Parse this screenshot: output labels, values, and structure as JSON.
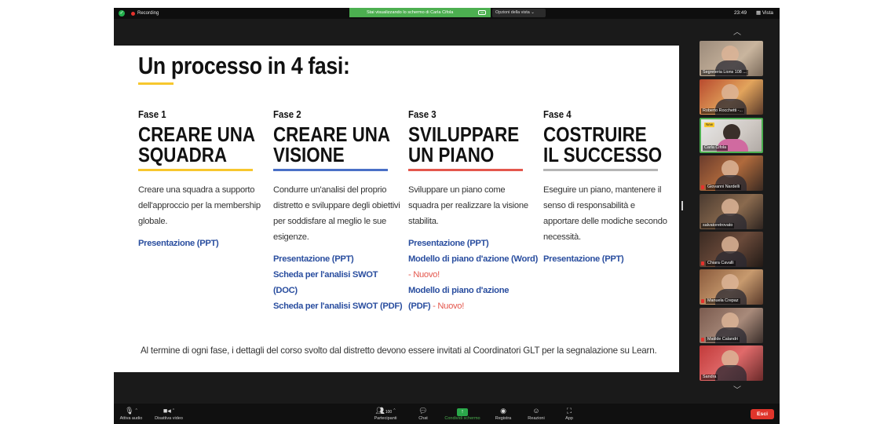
{
  "topbar": {
    "recording_label": "Recording",
    "sharing_banner": "Stai visualizzando lo schermo di Carla Cifola",
    "view_options": "Opzioni della vista ⌄",
    "clock": "23:49",
    "view_button": "Vista"
  },
  "slide": {
    "title": "Un processo in 4 fasi:",
    "phases": [
      {
        "label": "Fase 1",
        "heading_line1": "CREARE UNA",
        "heading_line2": "SQUADRA",
        "rule_color": "#f7c72e",
        "description": "Creare una squadra a supporto dell'approccio per la membership globale.",
        "links": [
          "Presentazione (PPT)"
        ]
      },
      {
        "label": "Fase 2",
        "heading_line1": "CREARE UNA",
        "heading_line2": "VISIONE",
        "rule_color": "#4a70c7",
        "description": "Condurre un'analisi del proprio distretto e sviluppare degli obiettivi per soddisfare al meglio le sue esigenze.",
        "links": [
          "Presentazione (PPT)",
          "Scheda per l'analisi SWOT (DOC)",
          "Scheda per l'analisi SWOT (PDF)"
        ]
      },
      {
        "label": "Fase 3",
        "heading_line1": "SVILUPPARE",
        "heading_line2": "UN PIANO",
        "rule_color": "#e4574d",
        "description": "Sviluppare un piano come squadra per realizzare la visione stabilita.",
        "links": [
          "Presentazione (PPT)",
          "Modello di piano d'azione (Word)",
          "Modello di piano d'azione (PDF)"
        ],
        "new_tag": "- Nuovo!"
      },
      {
        "label": "Fase 4",
        "heading_line1": "COSTRUIRE",
        "heading_line2": "IL SUCCESSO",
        "rule_color": "#b5b5b5",
        "description": "Eseguire un piano, mantenere il senso di responsabilità e apportare delle modiche secondo necessità.",
        "links": [
          "Presentazione (PPT)"
        ]
      }
    ],
    "footer_note": "Al termine di ogni fase, i dettagli del corso svolto dal distretto devono essere invitati al Coordinatori GLT per la segnalazione su Learn."
  },
  "participants": [
    {
      "name": "Segreteria Lions 108 ..."
    },
    {
      "name": "Roberto Rocchetti -..."
    },
    {
      "name": "Carla Cifola",
      "badge": "New"
    },
    {
      "name": "Giovanni Nardelli"
    },
    {
      "name": "salvatoretrovato"
    },
    {
      "name": "Chiara Cavalli"
    },
    {
      "name": "Manuela Crepaz"
    },
    {
      "name": "Matilde Calandri"
    },
    {
      "name": "Sandra"
    }
  ],
  "toolbar": {
    "audio_label": "Attiva audio",
    "video_label": "Disattiva video",
    "participants_label": "Partecipanti",
    "participants_count": "100",
    "chat_label": "Chat",
    "share_label": "Condividi schermo",
    "record_label": "Registra",
    "reactions_label": "Reazioni",
    "apps_label": "App",
    "leave_label": "Esci"
  },
  "colors": {
    "accent_green": "#4caf50",
    "leave_red": "#e0352b",
    "link_blue": "#2a4e9f"
  }
}
